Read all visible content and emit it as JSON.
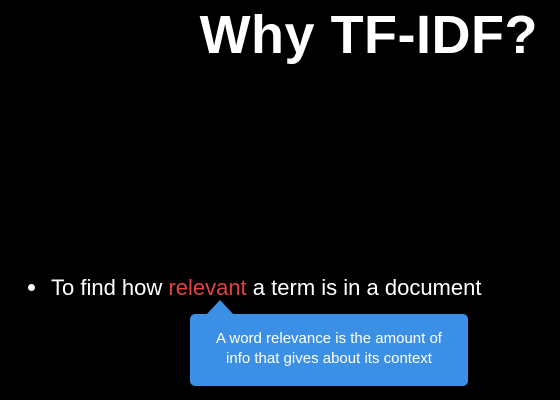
{
  "slide": {
    "title": "Why TF-IDF?",
    "bullet": {
      "before": "To find how ",
      "highlight": "relevant",
      "after": " a term is in a document"
    },
    "tooltip": {
      "line1": "A word relevance is the amount of",
      "line2": "info that gives about its context"
    }
  },
  "colors": {
    "background": "#000000",
    "text": "#ffffff",
    "highlight": "#e2433f",
    "tooltip": "#3b8fe5"
  }
}
